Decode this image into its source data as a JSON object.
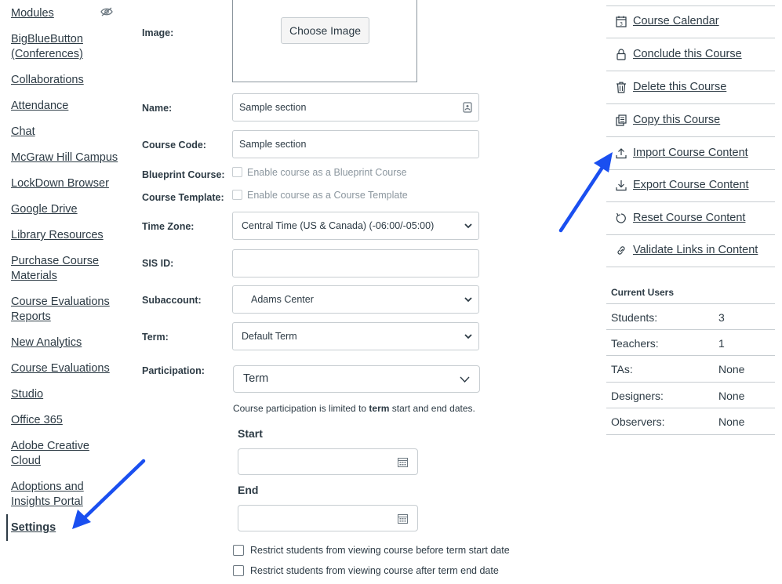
{
  "nav": {
    "items": [
      {
        "label": "Modules"
      },
      {
        "label": "BigBlueButton (Conferences)"
      },
      {
        "label": "Collaborations"
      },
      {
        "label": "Attendance"
      },
      {
        "label": "Chat"
      },
      {
        "label": "McGraw Hill Campus"
      },
      {
        "label": "LockDown Browser"
      },
      {
        "label": "Google Drive"
      },
      {
        "label": "Library Resources"
      },
      {
        "label": "Purchase Course Materials"
      },
      {
        "label": "Course Evaluations Reports"
      },
      {
        "label": "New Analytics"
      },
      {
        "label": "Course Evaluations"
      },
      {
        "label": "Studio"
      },
      {
        "label": "Office 365"
      },
      {
        "label": "Adobe Creative Cloud"
      },
      {
        "label": "Adoptions and Insights Portal"
      },
      {
        "label": "Settings"
      }
    ]
  },
  "form": {
    "image_label": "Image:",
    "choose_image": "Choose Image",
    "name_label": "Name:",
    "name_value": "Sample section",
    "course_code_label": "Course Code:",
    "course_code_value": "Sample section",
    "blueprint_label": "Blueprint Course:",
    "blueprint_option": "Enable course as a Blueprint Course",
    "template_label": "Course Template:",
    "template_option": "Enable course as a Course Template",
    "timezone_label": "Time Zone:",
    "timezone_value": "Central Time (US & Canada) (-06:00/-05:00)",
    "sis_label": "SIS ID:",
    "sis_value": "",
    "subaccount_label": "Subaccount:",
    "subaccount_value": "Adams Center",
    "term_label": "Term:",
    "term_value": "Default Term",
    "participation_label": "Participation:",
    "participation_value": "Term",
    "participation_note_pre": "Course participation is limited to ",
    "participation_note_bold": "term",
    "participation_note_post": " start and end dates.",
    "start_label": "Start",
    "end_label": "End",
    "restrict_before": "Restrict students from viewing course before term start date",
    "restrict_after": "Restrict students from viewing course after term end date"
  },
  "sidebar": {
    "links": [
      {
        "label": "Course Calendar",
        "icon": "calendar-icon"
      },
      {
        "label": "Conclude this Course",
        "icon": "lock-icon"
      },
      {
        "label": "Delete this Course",
        "icon": "trash-icon"
      },
      {
        "label": "Copy this Course",
        "icon": "copy-icon"
      },
      {
        "label": "Import Course Content",
        "icon": "upload-icon"
      },
      {
        "label": "Export Course Content",
        "icon": "download-icon"
      },
      {
        "label": "Reset Course Content",
        "icon": "reset-icon"
      },
      {
        "label": "Validate Links in Content",
        "icon": "link-icon"
      }
    ],
    "current_users_title": "Current Users",
    "users": [
      {
        "role": "Students:",
        "count": "3"
      },
      {
        "role": "Teachers:",
        "count": "1"
      },
      {
        "role": "TAs:",
        "count": "None"
      },
      {
        "role": "Designers:",
        "count": "None"
      },
      {
        "role": "Observers:",
        "count": "None"
      }
    ]
  },
  "colors": {
    "text": "#2d3b45",
    "border": "#c7cdd1",
    "arrow": "#1a4ff0"
  }
}
